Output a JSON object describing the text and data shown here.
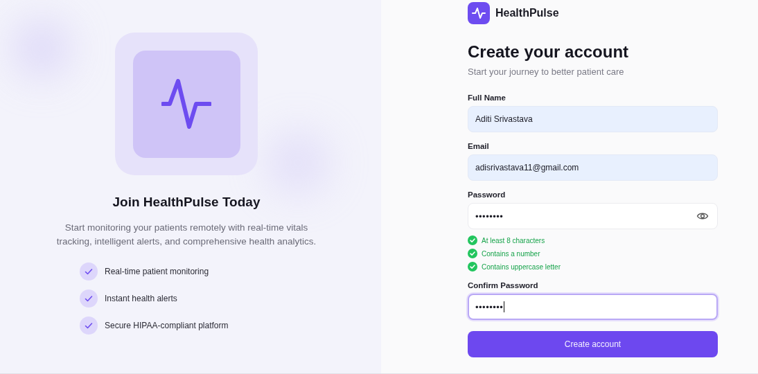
{
  "hero": {
    "title": "Join HealthPulse Today",
    "description": "Start monitoring your patients remotely with real-time vitals tracking, intelligent alerts, and comprehensive health analytics.",
    "features": [
      {
        "label": "Real-time patient monitoring"
      },
      {
        "label": "Instant health alerts"
      },
      {
        "label": "Secure HIPAA-compliant platform"
      }
    ]
  },
  "brand": {
    "name": "HealthPulse"
  },
  "form": {
    "title": "Create your account",
    "subtitle": "Start your journey to better patient care",
    "fields": [
      {
        "kind": "text",
        "label": "Full Name",
        "value": "Aditi Srivastava",
        "autofilled": true,
        "focused": false
      },
      {
        "kind": "text",
        "label": "Email",
        "value": "adisrivastava11@gmail.com",
        "autofilled": true,
        "focused": false
      },
      {
        "kind": "password",
        "label": "Password",
        "value": "••••••••",
        "autofilled": false,
        "focused": false,
        "rules": [
          {
            "label": "At least 8 characters",
            "met": true
          },
          {
            "label": "Contains a number",
            "met": true
          },
          {
            "label": "Contains uppercase letter",
            "met": true
          }
        ]
      },
      {
        "kind": "confirm",
        "label": "Confirm Password",
        "value": "••••••••",
        "autofilled": false,
        "focused": true
      }
    ],
    "submit": "Create account"
  }
}
